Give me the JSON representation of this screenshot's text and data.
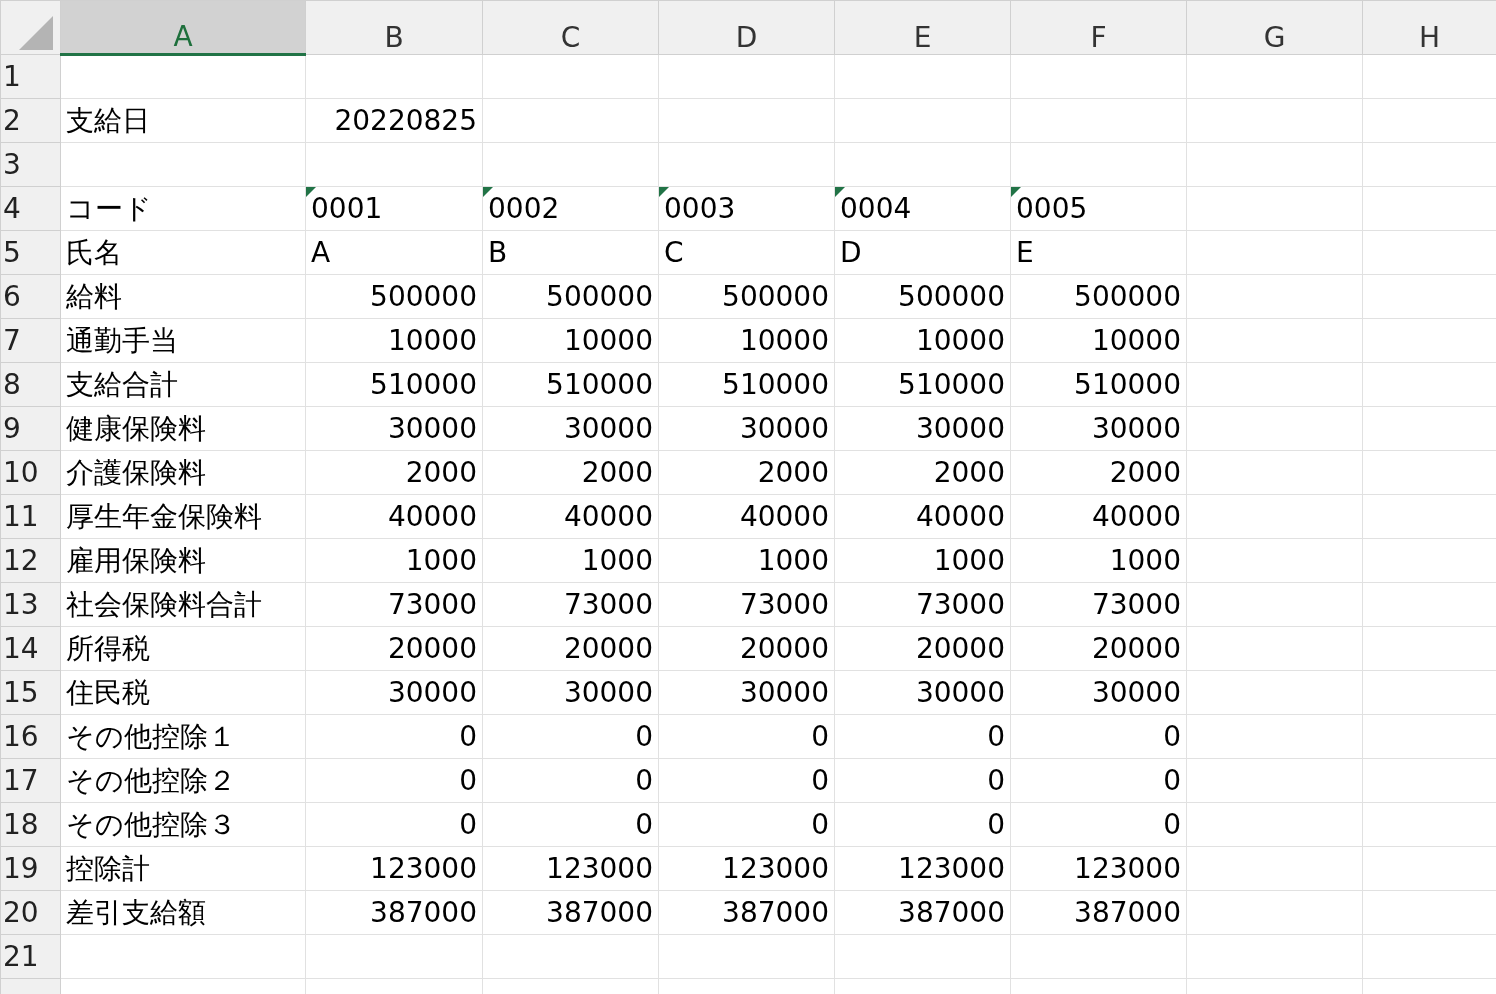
{
  "columns": [
    {
      "label": "A",
      "selected": true
    },
    {
      "label": "B",
      "selected": false
    },
    {
      "label": "C",
      "selected": false
    },
    {
      "label": "D",
      "selected": false
    },
    {
      "label": "E",
      "selected": false
    },
    {
      "label": "F",
      "selected": false
    },
    {
      "label": "G",
      "selected": false
    },
    {
      "label": "H",
      "selected": false
    }
  ],
  "rows": [
    {
      "header": "1",
      "cells": []
    },
    {
      "header": "2",
      "cells": [
        {
          "text": "支給日",
          "kind": "text"
        },
        {
          "text": "20220825",
          "kind": "number"
        }
      ]
    },
    {
      "header": "3",
      "cells": []
    },
    {
      "header": "4",
      "cells": [
        {
          "text": "コード",
          "kind": "text"
        },
        {
          "text": "0001",
          "kind": "text",
          "flag": true
        },
        {
          "text": "0002",
          "kind": "text",
          "flag": true
        },
        {
          "text": "0003",
          "kind": "text",
          "flag": true
        },
        {
          "text": "0004",
          "kind": "text",
          "flag": true
        },
        {
          "text": "0005",
          "kind": "text",
          "flag": true
        }
      ]
    },
    {
      "header": "5",
      "cells": [
        {
          "text": "氏名",
          "kind": "text"
        },
        {
          "text": "A",
          "kind": "text"
        },
        {
          "text": "B",
          "kind": "text"
        },
        {
          "text": "C",
          "kind": "text"
        },
        {
          "text": "D",
          "kind": "text"
        },
        {
          "text": "E",
          "kind": "text"
        }
      ]
    },
    {
      "header": "6",
      "cells": [
        {
          "text": "給料",
          "kind": "text"
        },
        {
          "text": "500000",
          "kind": "number"
        },
        {
          "text": "500000",
          "kind": "number"
        },
        {
          "text": "500000",
          "kind": "number"
        },
        {
          "text": "500000",
          "kind": "number"
        },
        {
          "text": "500000",
          "kind": "number"
        }
      ]
    },
    {
      "header": "7",
      "cells": [
        {
          "text": "通勤手当",
          "kind": "text"
        },
        {
          "text": "10000",
          "kind": "number"
        },
        {
          "text": "10000",
          "kind": "number"
        },
        {
          "text": "10000",
          "kind": "number"
        },
        {
          "text": "10000",
          "kind": "number"
        },
        {
          "text": "10000",
          "kind": "number"
        }
      ]
    },
    {
      "header": "8",
      "cells": [
        {
          "text": "支給合計",
          "kind": "text"
        },
        {
          "text": "510000",
          "kind": "number"
        },
        {
          "text": "510000",
          "kind": "number"
        },
        {
          "text": "510000",
          "kind": "number"
        },
        {
          "text": "510000",
          "kind": "number"
        },
        {
          "text": "510000",
          "kind": "number"
        }
      ]
    },
    {
      "header": "9",
      "cells": [
        {
          "text": "健康保険料",
          "kind": "text"
        },
        {
          "text": "30000",
          "kind": "number"
        },
        {
          "text": "30000",
          "kind": "number"
        },
        {
          "text": "30000",
          "kind": "number"
        },
        {
          "text": "30000",
          "kind": "number"
        },
        {
          "text": "30000",
          "kind": "number"
        }
      ]
    },
    {
      "header": "10",
      "cells": [
        {
          "text": "介護保険料",
          "kind": "text"
        },
        {
          "text": "2000",
          "kind": "number"
        },
        {
          "text": "2000",
          "kind": "number"
        },
        {
          "text": "2000",
          "kind": "number"
        },
        {
          "text": "2000",
          "kind": "number"
        },
        {
          "text": "2000",
          "kind": "number"
        }
      ]
    },
    {
      "header": "11",
      "cells": [
        {
          "text": "厚生年金保険料",
          "kind": "text"
        },
        {
          "text": "40000",
          "kind": "number"
        },
        {
          "text": "40000",
          "kind": "number"
        },
        {
          "text": "40000",
          "kind": "number"
        },
        {
          "text": "40000",
          "kind": "number"
        },
        {
          "text": "40000",
          "kind": "number"
        }
      ]
    },
    {
      "header": "12",
      "cells": [
        {
          "text": "雇用保険料",
          "kind": "text"
        },
        {
          "text": "1000",
          "kind": "number"
        },
        {
          "text": "1000",
          "kind": "number"
        },
        {
          "text": "1000",
          "kind": "number"
        },
        {
          "text": "1000",
          "kind": "number"
        },
        {
          "text": "1000",
          "kind": "number"
        }
      ]
    },
    {
      "header": "13",
      "cells": [
        {
          "text": "社会保険料合計",
          "kind": "text"
        },
        {
          "text": "73000",
          "kind": "number"
        },
        {
          "text": "73000",
          "kind": "number"
        },
        {
          "text": "73000",
          "kind": "number"
        },
        {
          "text": "73000",
          "kind": "number"
        },
        {
          "text": "73000",
          "kind": "number"
        }
      ]
    },
    {
      "header": "14",
      "cells": [
        {
          "text": "所得税",
          "kind": "text"
        },
        {
          "text": "20000",
          "kind": "number"
        },
        {
          "text": "20000",
          "kind": "number"
        },
        {
          "text": "20000",
          "kind": "number"
        },
        {
          "text": "20000",
          "kind": "number"
        },
        {
          "text": "20000",
          "kind": "number"
        }
      ]
    },
    {
      "header": "15",
      "cells": [
        {
          "text": "住民税",
          "kind": "text"
        },
        {
          "text": "30000",
          "kind": "number"
        },
        {
          "text": "30000",
          "kind": "number"
        },
        {
          "text": "30000",
          "kind": "number"
        },
        {
          "text": "30000",
          "kind": "number"
        },
        {
          "text": "30000",
          "kind": "number"
        }
      ]
    },
    {
      "header": "16",
      "cells": [
        {
          "text": "その他控除１",
          "kind": "text"
        },
        {
          "text": "0",
          "kind": "number"
        },
        {
          "text": "0",
          "kind": "number"
        },
        {
          "text": "0",
          "kind": "number"
        },
        {
          "text": "0",
          "kind": "number"
        },
        {
          "text": "0",
          "kind": "number"
        }
      ]
    },
    {
      "header": "17",
      "cells": [
        {
          "text": "その他控除２",
          "kind": "text"
        },
        {
          "text": "0",
          "kind": "number"
        },
        {
          "text": "0",
          "kind": "number"
        },
        {
          "text": "0",
          "kind": "number"
        },
        {
          "text": "0",
          "kind": "number"
        },
        {
          "text": "0",
          "kind": "number"
        }
      ]
    },
    {
      "header": "18",
      "cells": [
        {
          "text": "その他控除３",
          "kind": "text"
        },
        {
          "text": "0",
          "kind": "number"
        },
        {
          "text": "0",
          "kind": "number"
        },
        {
          "text": "0",
          "kind": "number"
        },
        {
          "text": "0",
          "kind": "number"
        },
        {
          "text": "0",
          "kind": "number"
        }
      ]
    },
    {
      "header": "19",
      "cells": [
        {
          "text": "控除計",
          "kind": "text"
        },
        {
          "text": "123000",
          "kind": "number"
        },
        {
          "text": "123000",
          "kind": "number"
        },
        {
          "text": "123000",
          "kind": "number"
        },
        {
          "text": "123000",
          "kind": "number"
        },
        {
          "text": "123000",
          "kind": "number"
        }
      ]
    },
    {
      "header": "20",
      "cells": [
        {
          "text": "差引支給額",
          "kind": "text"
        },
        {
          "text": "387000",
          "kind": "number"
        },
        {
          "text": "387000",
          "kind": "number"
        },
        {
          "text": "387000",
          "kind": "number"
        },
        {
          "text": "387000",
          "kind": "number"
        },
        {
          "text": "387000",
          "kind": "number"
        }
      ]
    },
    {
      "header": "21",
      "cells": []
    }
  ]
}
